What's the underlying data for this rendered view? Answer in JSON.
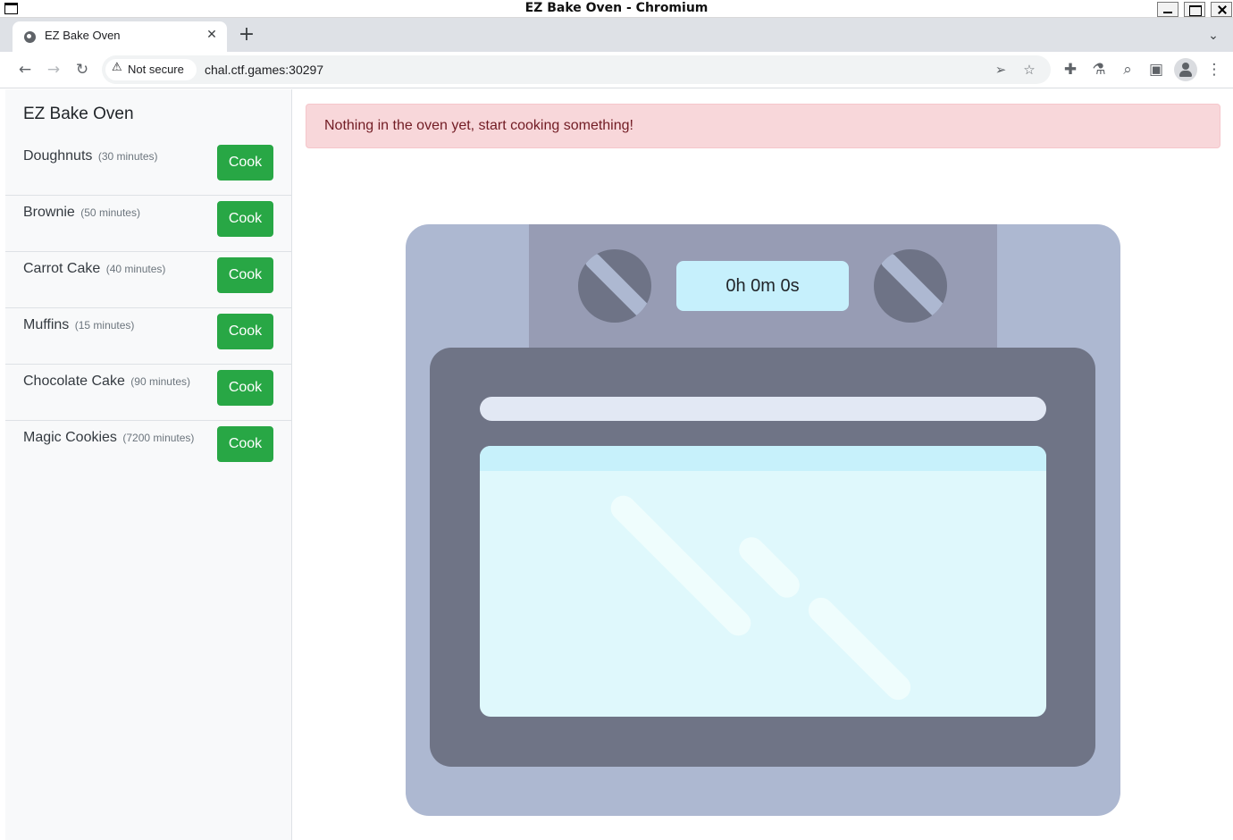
{
  "window": {
    "title": "EZ Bake Oven - Chromium"
  },
  "browser": {
    "tab_title": "EZ Bake Oven",
    "tab_close": "✕",
    "new_tab": "+",
    "tab_search": "⌄",
    "security_label": "Not secure",
    "url": "chal.ctf.games:30297"
  },
  "app": {
    "title": "EZ Bake Oven",
    "cook_label": "Cook",
    "recipes": [
      {
        "name": "Doughnuts",
        "time": "(30 minutes)"
      },
      {
        "name": "Brownie",
        "time": "(50 minutes)"
      },
      {
        "name": "Carrot Cake",
        "time": "(40 minutes)"
      },
      {
        "name": "Muffins",
        "time": "(15 minutes)"
      },
      {
        "name": "Chocolate Cake",
        "time": "(90 minutes)"
      },
      {
        "name": "Magic Cookies",
        "time": "(7200 minutes)"
      }
    ],
    "alert": "Nothing in the oven yet, start cooking something!",
    "timer": "0h 0m 0s"
  },
  "colors": {
    "cook_button": "#28a745",
    "alert_background": "#f8d7da",
    "alert_text": "#721c24",
    "oven_body": "#adb8d1",
    "oven_door": "#6f7486",
    "oven_window": "#dff8fc"
  },
  "icons": {
    "back": "back-arrow-icon",
    "forward": "forward-arrow-icon",
    "reload": "reload-icon",
    "security": "warning-triangle-icon",
    "share": "send-icon",
    "bookmark": "star-icon",
    "extensions": "puzzle-icon",
    "labs": "flask-icon",
    "zoom": "magnifier-icon",
    "side_panel": "side-panel-icon",
    "profile": "profile-icon",
    "menu": "kebab-menu-icon"
  }
}
